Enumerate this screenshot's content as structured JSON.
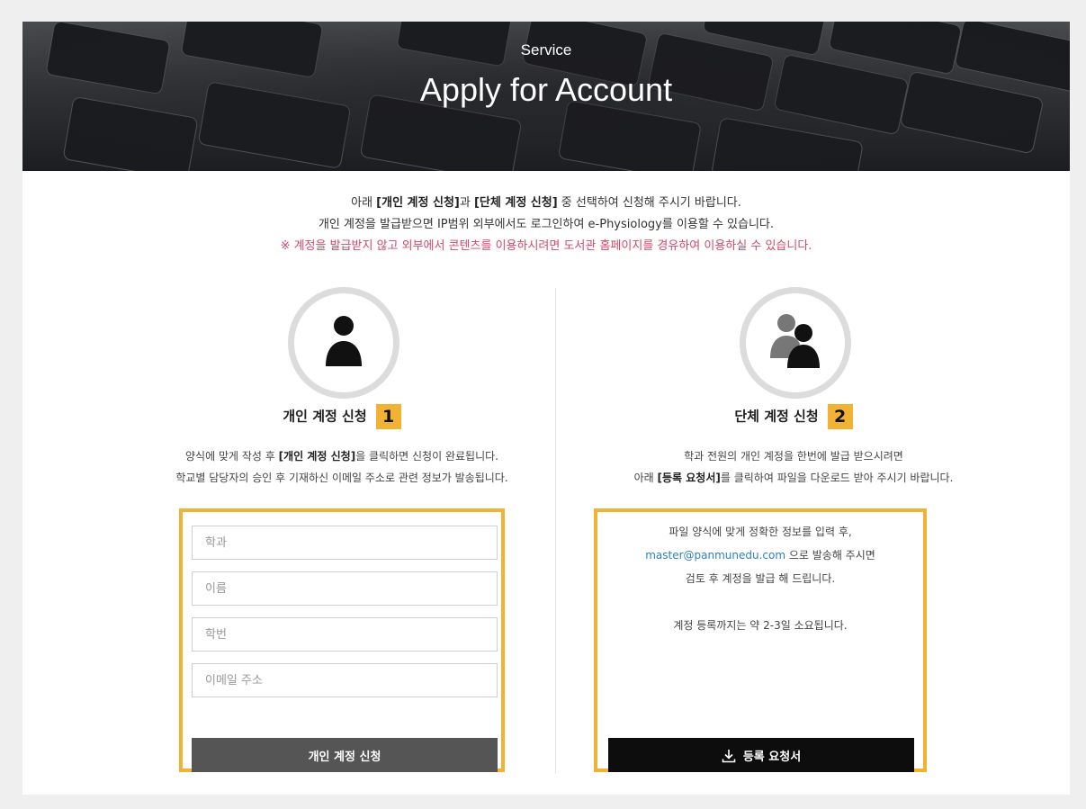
{
  "banner": {
    "subtitle": "Service",
    "title": "Apply for Account"
  },
  "intro": {
    "line1_pre": "아래 ",
    "line1_b1": "[개인 계정 신청]",
    "line1_mid": "과 ",
    "line1_b2": "[단체 계정 신청]",
    "line1_post": " 중 선택하여 신청해 주시기 바랍니다.",
    "line2": "개인 계정을 발급받으면 IP범위 외부에서도 로그인하여 e-Physiology를 이용할 수 있습니다.",
    "line3": "※ 계정을 발급받지 않고 외부에서 콘텐츠를 이용하시려면 도서관 홈페이지를 경유하여 이용하실 수 있습니다."
  },
  "individual": {
    "heading": "개인 계정 신청",
    "number": "1",
    "desc1_pre": "양식에 맞게 작성 후 ",
    "desc1_b": "[개인 계정 신청]",
    "desc1_post": "을 클릭하면 신청이 완료됩니다.",
    "desc2": "학교별 담당자의 승인 후 기재하신 이메일 주소로 관련 정보가 발송됩니다.",
    "fields": {
      "department": "학과",
      "name": "이름",
      "student_id": "학번",
      "email": "이메일 주소"
    },
    "button": "개인 계정 신청"
  },
  "group": {
    "heading": "단체 계정 신청",
    "number": "2",
    "desc1": "학과 전원의 개인 계정을 한번에 발급 받으시려면",
    "desc2_pre": "아래 ",
    "desc2_b": "[등록 요청서]",
    "desc2_post": "를 클릭하여 파일을 다운로드 받아 주시기 바랍니다.",
    "info1": "파일 양식에 맞게 정확한 정보를 입력 후,",
    "info2_email": "master@panmunedu.com",
    "info2_post": " 으로 발송해 주시면",
    "info3": "검토 후 계정을 발급 해 드립니다.",
    "info4": "계정 등록까지는 약 2-3일 소요됩니다.",
    "button": "등록 요청서",
    "button_icon": "download-icon"
  },
  "colors": {
    "accent": "#f2b233",
    "warning_text": "#d5476a",
    "email_link": "#2f7fc1",
    "apply_button": "#555555",
    "download_button": "#0d0d0d"
  }
}
